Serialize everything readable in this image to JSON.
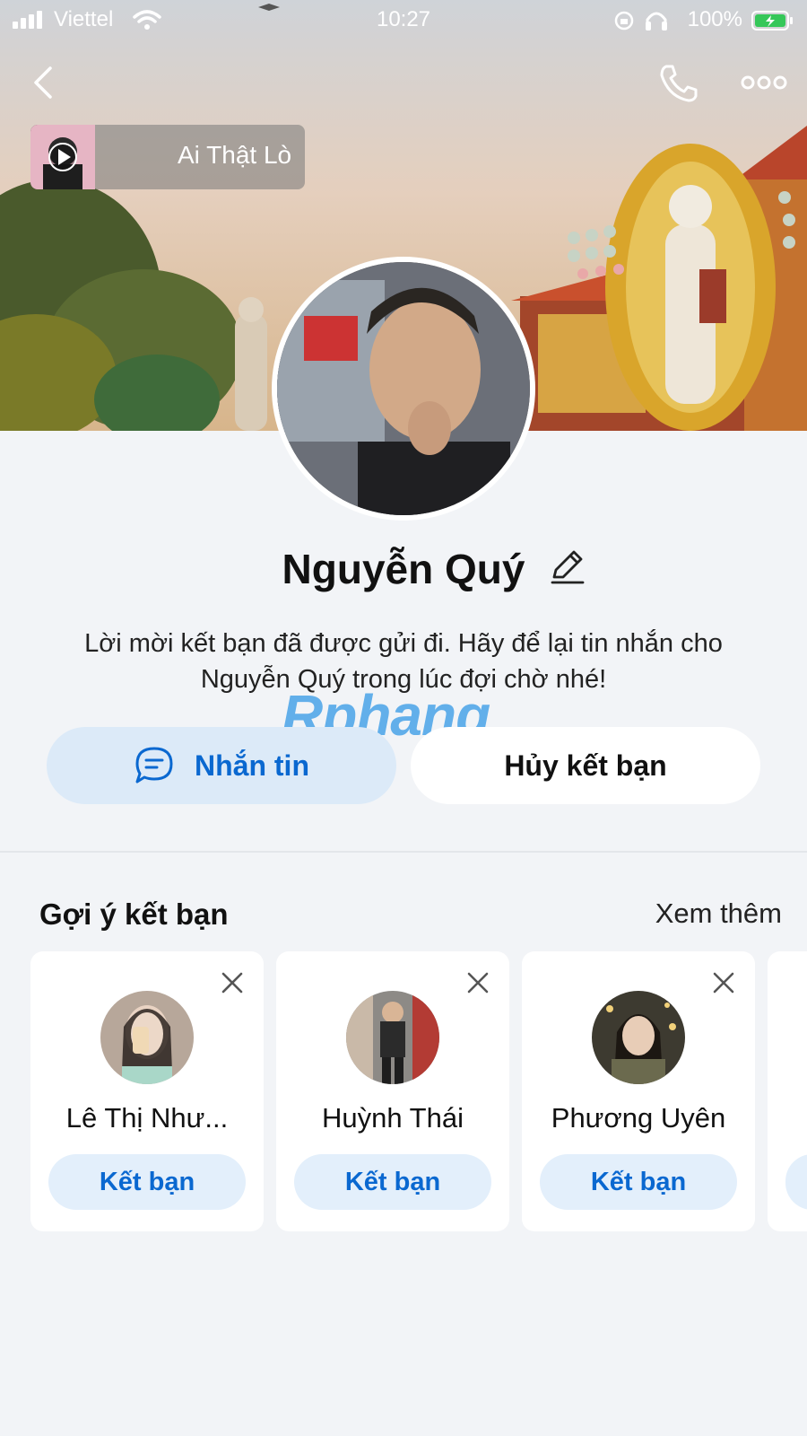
{
  "status_bar": {
    "carrier": "Viettel",
    "time": "10:27",
    "battery": "100%"
  },
  "cover": {
    "music_title": "Ai Thật Lò"
  },
  "profile": {
    "name": "Nguyễn Quý",
    "message": "Lời mời kết bạn đã được gửi đi. Hãy để lại tin nhắn cho Nguyễn Quý trong lúc đợi chờ nhé!",
    "watermark": "Rphang"
  },
  "actions": {
    "message_label": "Nhắn tin",
    "unfriend_label": "Hủy kết bạn"
  },
  "suggestions": {
    "title": "Gợi ý kết bạn",
    "see_more": "Xem thêm",
    "items": [
      {
        "name": "Lê Thị Như...",
        "button": "Kết bạn"
      },
      {
        "name": "Huỳnh Thái",
        "button": "Kết bạn"
      },
      {
        "name": "Phương Uyên",
        "button": "Kết bạn"
      }
    ]
  },
  "colors": {
    "accent": "#0a68d0",
    "button_bg": "#dceaf8",
    "page_bg": "#f2f4f7"
  }
}
